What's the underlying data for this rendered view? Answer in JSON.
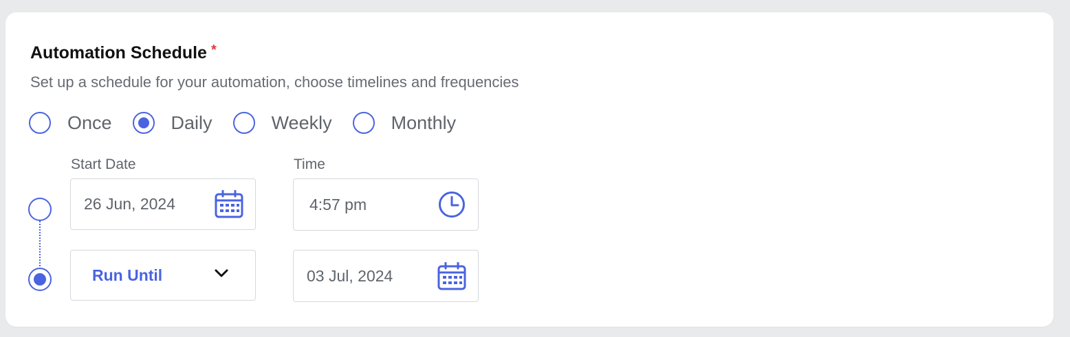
{
  "section": {
    "title": "Automation Schedule",
    "required_marker": "*",
    "subtitle": "Set up a schedule for your automation, choose timelines and frequencies"
  },
  "frequency": {
    "options": [
      "Once",
      "Daily",
      "Weekly",
      "Monthly"
    ],
    "selected": "Daily"
  },
  "start": {
    "date_label": "Start Date",
    "date_value": "26 Jun, 2024",
    "date_icon": "calendar-icon",
    "time_label": "Time",
    "time_value": "4:57 pm",
    "time_icon": "clock-icon",
    "selected": false
  },
  "end": {
    "mode_label": "Run Until",
    "mode_icon": "chevron-down-icon",
    "date_value": "03 Jul, 2024",
    "date_icon": "calendar-icon",
    "selected": true
  },
  "colors": {
    "accent": "#4a63e0",
    "required": "#e23b3b",
    "text_muted": "#5f646b",
    "background": "#e9eaec"
  }
}
